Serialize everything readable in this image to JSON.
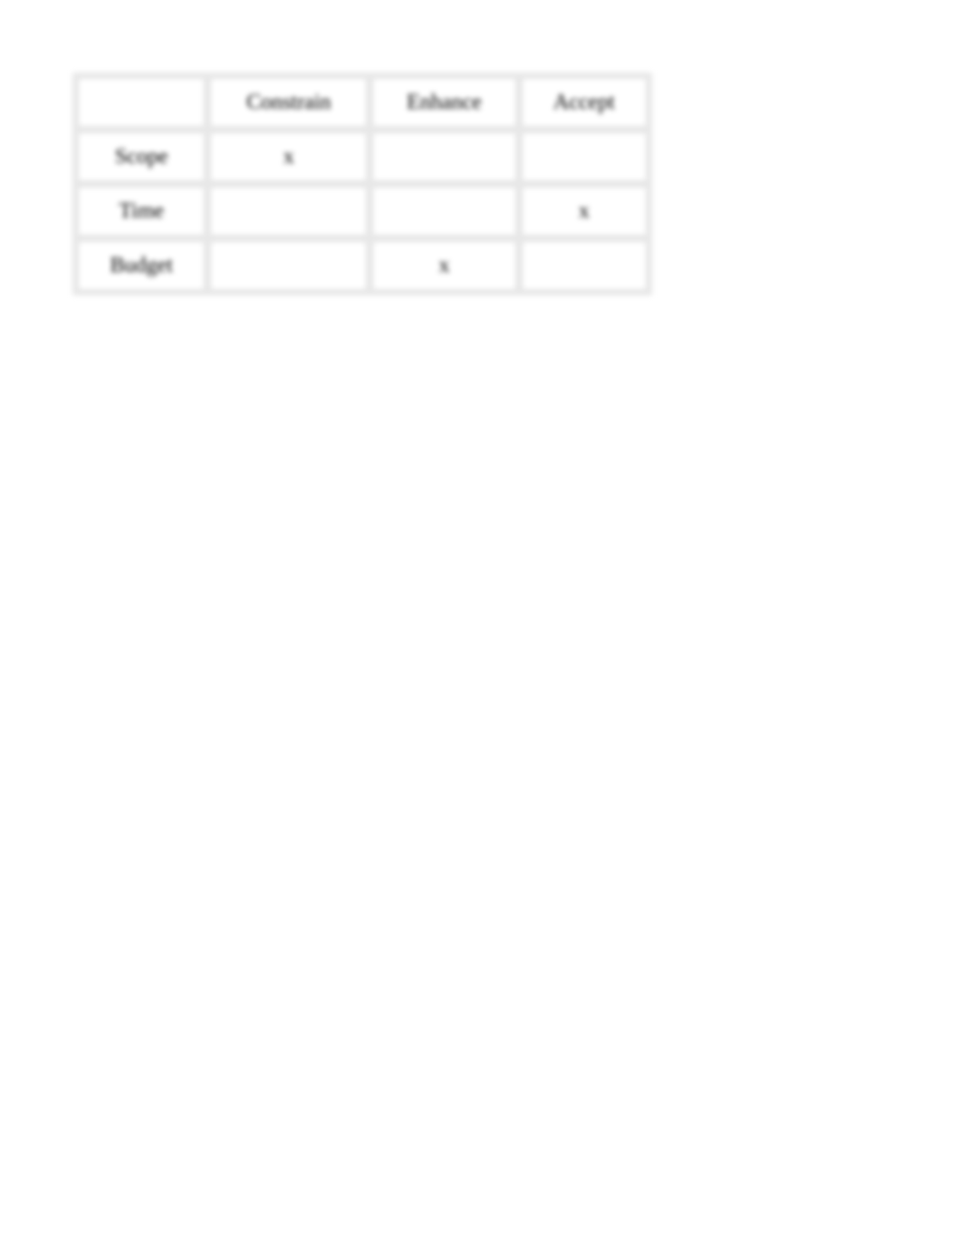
{
  "chart_data": {
    "type": "table",
    "column_headers": [
      "",
      "Constrain",
      "Enhance",
      "Accept"
    ],
    "row_headers": [
      "Scope",
      "Time",
      "Budget"
    ],
    "cells": [
      [
        "x",
        "",
        ""
      ],
      [
        "",
        "",
        "x"
      ],
      [
        "",
        "x",
        ""
      ]
    ]
  }
}
